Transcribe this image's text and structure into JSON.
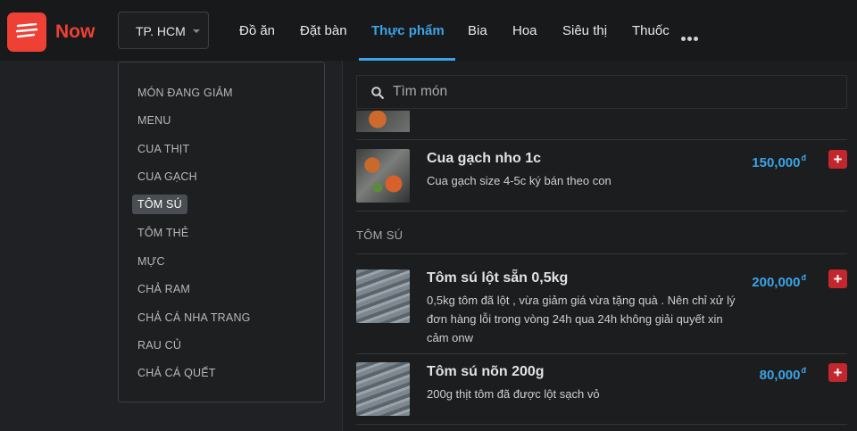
{
  "brand": {
    "name": "Now",
    "color": "#ee4034",
    "icon": "now-logo-icon"
  },
  "city_selector": {
    "value": "TP. HCM"
  },
  "nav": {
    "items": [
      {
        "label": "Đồ ăn",
        "active": false
      },
      {
        "label": "Đặt bàn",
        "active": false
      },
      {
        "label": "Thực phẩm",
        "active": true
      },
      {
        "label": "Bia",
        "active": false
      },
      {
        "label": "Hoa",
        "active": false
      },
      {
        "label": "Siêu thị",
        "active": false
      },
      {
        "label": "Thuốc",
        "active": false
      }
    ],
    "more_icon": "more-dots-icon",
    "active_color": "#3ba4e6"
  },
  "category_menu": {
    "items": [
      {
        "label": "MÓN ĐANG GIẢM",
        "selected": false
      },
      {
        "label": "MENU",
        "selected": false
      },
      {
        "label": "CUA THỊT",
        "selected": false
      },
      {
        "label": "CUA GẠCH",
        "selected": false
      },
      {
        "label": "TÔM SÚ",
        "selected": true
      },
      {
        "label": "TÔM THẺ",
        "selected": false
      },
      {
        "label": "MỰC",
        "selected": false
      },
      {
        "label": "CHẢ RAM",
        "selected": false
      },
      {
        "label": "CHẢ CÁ NHA TRANG",
        "selected": false
      },
      {
        "label": "RAU CỦ",
        "selected": false
      },
      {
        "label": "CHẢ CÁ QUẾT",
        "selected": false
      }
    ]
  },
  "search": {
    "placeholder": "Tìm món",
    "value": "",
    "icon": "search-icon"
  },
  "sections": [
    {
      "title": "",
      "items": [
        {
          "name": "Cua gạch nho 1c",
          "description": "Cua gạch size 4-5c ký bán theo con",
          "price": "150,000",
          "currency": "đ"
        }
      ]
    },
    {
      "title": "TÔM SÚ",
      "items": [
        {
          "name": "Tôm sú lột sẵn 0,5kg",
          "description": "0,5kg tôm đã lột , vừa giảm giá vừa tặng quà . Nên chỉ xử lý đơn hàng lỗi trong vòng 24h qua 24h không giải quyết xin cảm onw",
          "price": "200,000",
          "currency": "đ"
        },
        {
          "name": "Tôm sú nõn 200g",
          "description": "200g thịt tôm đã được lột sạch vỏ",
          "price": "80,000",
          "currency": "đ"
        }
      ]
    }
  ],
  "add_button": {
    "label": "+",
    "color": "#c1272d",
    "icon": "plus-icon"
  },
  "price_color": "#3ba4e6"
}
